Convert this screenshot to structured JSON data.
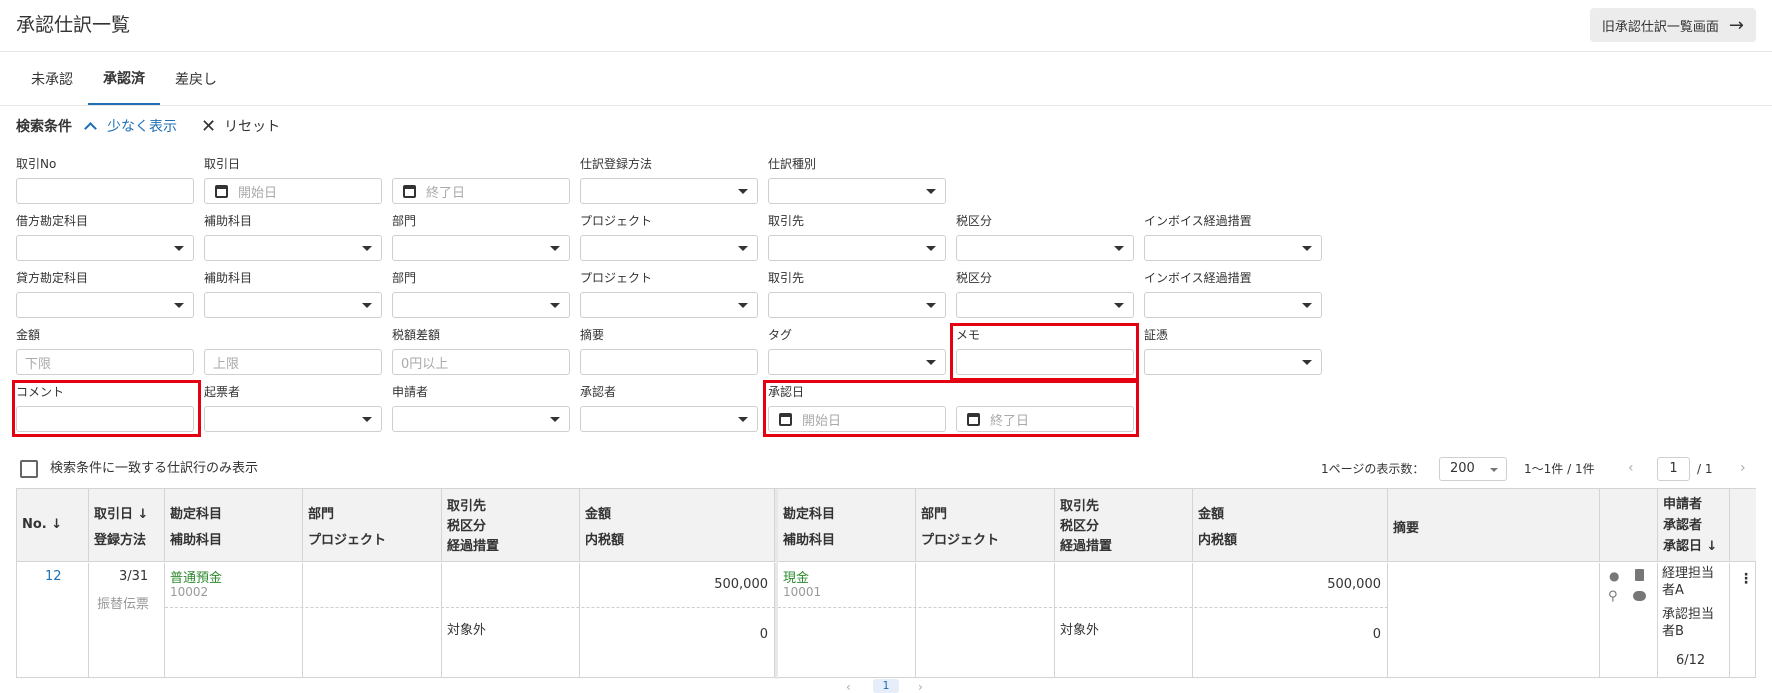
{
  "header": {
    "title": "承認仕訳一覧",
    "old_link": "旧承認仕訳一覧画面",
    "arrow": "→"
  },
  "tabs": [
    {
      "label": "未承認"
    },
    {
      "label": "承認済"
    },
    {
      "label": "差戻し"
    }
  ],
  "search": {
    "title": "検索条件",
    "less": "少なく表示",
    "reset": "リセット",
    "row1": {
      "torihiki_no": "取引No",
      "torihiki_bi": "取引日",
      "start_ph": "開始日",
      "end_ph": "終了日",
      "touroku": "仕訳登録方法",
      "shubetsu": "仕訳種別"
    },
    "row2": {
      "kamoku": "借方勘定科目",
      "hojo": "補助科目",
      "bumon": "部門",
      "project": "プロジェクト",
      "torihikisaki": "取引先",
      "zeikubun": "税区分",
      "invoice": "インボイス経過措置"
    },
    "row3": {
      "kamoku": "貸方勘定科目",
      "hojo": "補助科目",
      "bumon": "部門",
      "project": "プロジェクト",
      "torihikisaki": "取引先",
      "zeikubun": "税区分",
      "invoice": "インボイス経過措置"
    },
    "row4": {
      "kingaku": "金額",
      "lower_ph": "下限",
      "upper_ph": "上限",
      "zeigaku": "税額差額",
      "zeigaku_ph": "0円以上",
      "tekiyou": "摘要",
      "tag": "タグ",
      "memo": "メモ",
      "shouhyou": "証憑"
    },
    "row5": {
      "comment": "コメント",
      "kihyousha": "起票者",
      "shinseisha": "申請者",
      "shouninsha": "承認者",
      "shouninbi": "承認日",
      "start_ph": "開始日",
      "end_ph": "終了日"
    }
  },
  "options": {
    "only_match": "検索条件に一致する仕訳行のみ表示",
    "per_page_label": "1ページの表示数：",
    "per_page": "200",
    "range": "1〜1件 / 1件",
    "page": "1",
    "total_pages": "/ 1",
    "prev": "‹",
    "next": "›"
  },
  "table": {
    "headers": {
      "no": "No. ↓",
      "date1": "取引日 ↓",
      "date2": "登録方法",
      "d_kamoku1": "勘定科目",
      "d_kamoku2": "補助科目",
      "d_bumon1": "部門",
      "d_bumon2": "プロジェクト",
      "d_tori1": "取引先",
      "d_tori2": "税区分",
      "d_tori3": "経過措置",
      "d_kin1": "金額",
      "d_kin2": "内税額",
      "c_kamoku1": "勘定科目",
      "c_kamoku2": "補助科目",
      "c_bumon1": "部門",
      "c_bumon2": "プロジェクト",
      "c_tori1": "取引先",
      "c_tori2": "税区分",
      "c_tori3": "経過措置",
      "c_kin1": "金額",
      "c_kin2": "内税額",
      "tekiyou": "摘要",
      "app1": "申請者",
      "app2": "承認者",
      "app3": "承認日 ↓"
    },
    "row": {
      "no": "12",
      "date": "3/31",
      "method": "振替伝票",
      "d_kamoku": "普通預金",
      "d_code": "10002",
      "d_zei": "対象外",
      "d_amount": "500,000",
      "d_tax": "0",
      "c_kamoku": "現金",
      "c_code": "10001",
      "c_zei": "対象外",
      "c_amount": "500,000",
      "c_tax": "0",
      "applicant": "経理担当者A",
      "approver": "承認担当者B",
      "approved_date": "6/12",
      "more": "⋮"
    }
  },
  "bottom_pager": {
    "prev": "‹",
    "page": "1",
    "next": "›"
  }
}
